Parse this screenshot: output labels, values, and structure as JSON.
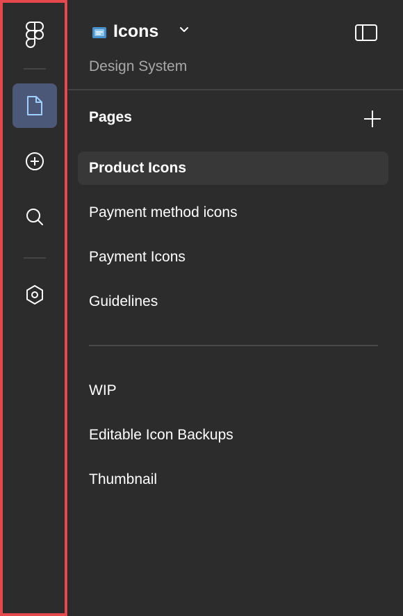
{
  "rail": {
    "items": [
      {
        "icon": "figma-logo-icon"
      },
      {
        "icon": "file-icon",
        "active": true
      },
      {
        "icon": "add-circle-icon"
      },
      {
        "icon": "search-icon"
      },
      {
        "icon": "plugin-hexagon-icon"
      }
    ],
    "highlight_color": "#e5484d",
    "active_color": "#4c5877"
  },
  "file": {
    "name": "Icons",
    "project": "Design System",
    "thumb_icon": "file-thumbnail-icon"
  },
  "pages": {
    "title": "Pages",
    "groups": [
      [
        "Product Icons",
        "Payment method icons",
        "Payment Icons",
        "Guidelines"
      ],
      [
        "WIP",
        "Editable Icon Backups",
        "Thumbnail"
      ]
    ],
    "selected": "Product Icons"
  }
}
